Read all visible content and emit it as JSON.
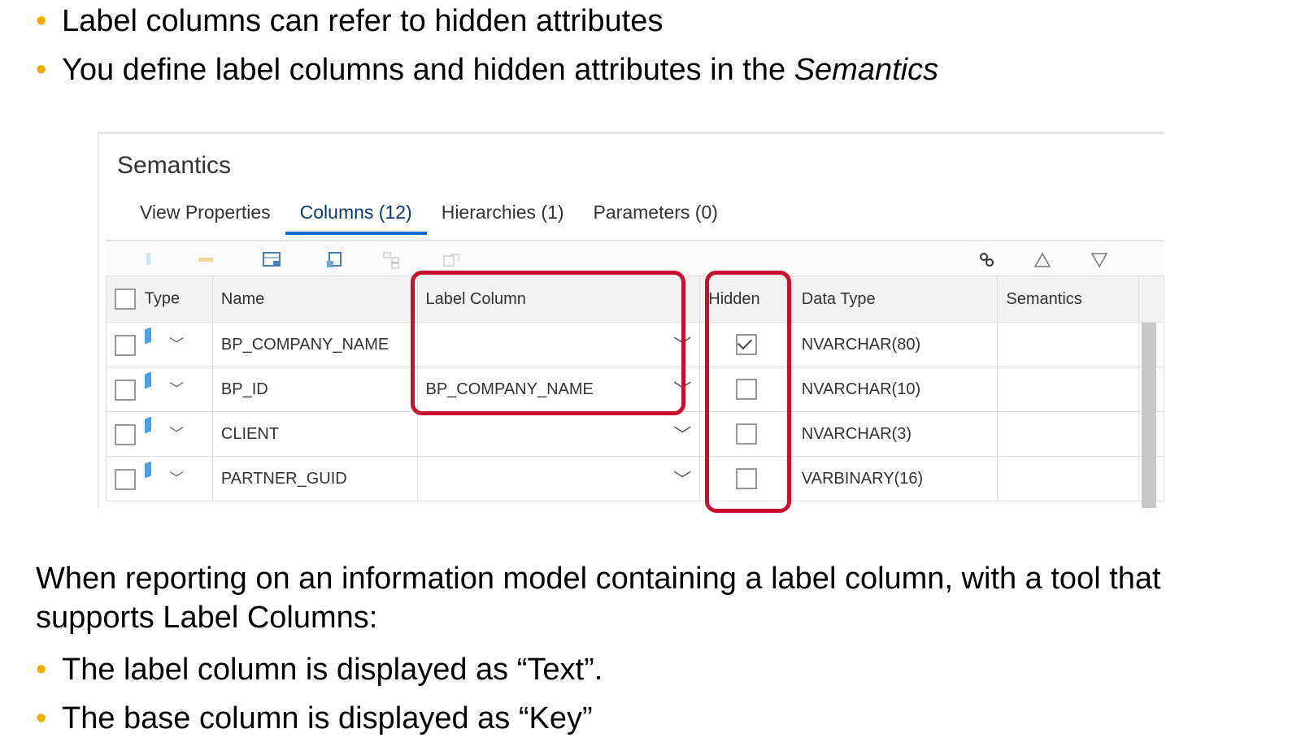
{
  "bullets_top": [
    "Label columns can refer to hidden attributes",
    "You define label columns and hidden attributes in the "
  ],
  "bullets_top_em": "Semantics",
  "panel": {
    "title": "Semantics",
    "tabs": [
      "View Properties",
      "Columns (12)",
      "Hierarchies (1)",
      "Parameters (0)"
    ],
    "active_tab": "Columns (12)",
    "columns": [
      "Type",
      "Name",
      "Label Column",
      "Hidden",
      "Data Type",
      "Semantics"
    ],
    "rows": [
      {
        "name": "BP_COMPANY_NAME",
        "label": "",
        "hidden": true,
        "type": "NVARCHAR(80)"
      },
      {
        "name": "BP_ID",
        "label": "BP_COMPANY_NAME",
        "hidden": false,
        "type": "NVARCHAR(10)"
      },
      {
        "name": "CLIENT",
        "label": "",
        "hidden": false,
        "type": "NVARCHAR(3)"
      },
      {
        "name": "PARTNER_GUID",
        "label": "",
        "hidden": false,
        "type": "VARBINARY(16)"
      }
    ]
  },
  "intro": "When reporting on an information model containing a label column, with a tool that supports Label Columns:",
  "bullets_bottom": [
    "The label column is displayed as “Text”.",
    "The base column is displayed as “Key”"
  ],
  "colors": {
    "bullet": "#f0ab00",
    "highlight": "#c8102e",
    "active_tab": "#0a6ed1"
  }
}
